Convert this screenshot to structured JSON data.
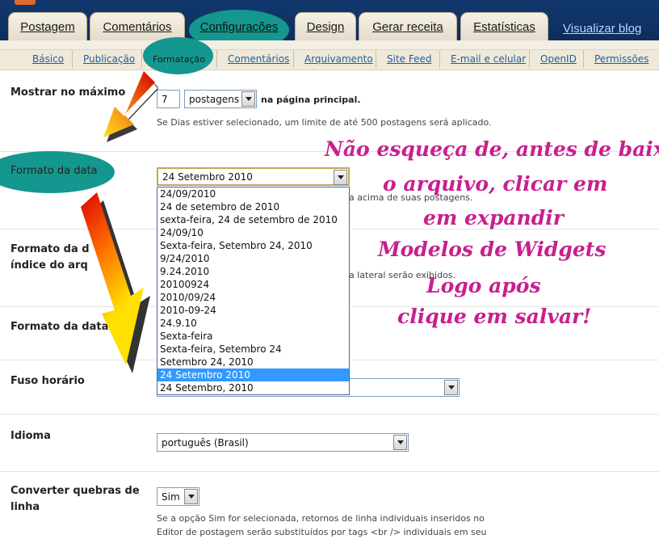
{
  "main_tabs": [
    "Postagem",
    "Comentários",
    "Configurações",
    "Design",
    "Gerar receita",
    "Estatísticas"
  ],
  "view_blog": "Visualizar blog",
  "sub_tabs": [
    "Básico",
    "Publicação",
    "Formatação",
    "Comentários",
    "Arquivamento",
    "Site Feed",
    "E-mail e celular",
    "OpenID",
    "Permissões"
  ],
  "settings": {
    "show_max": {
      "label": "Mostrar no máximo",
      "value": "7",
      "unit": "postagens",
      "suffix": "na página principal.",
      "hint": "Se Dias estiver selecionado, um limite de até 500 postagens será aplicado."
    },
    "date_format": {
      "label": "Formato da data",
      "value": "24 Setembro 2010",
      "hint_visible": "a acima de suas postagens."
    },
    "archive_format": {
      "label_line1": "Formato da d",
      "label_line2": "índice do arq",
      "hint_visible": "a lateral serão exibidos."
    },
    "comment_date": {
      "label": "Formato da data e"
    },
    "timezone": {
      "label": "Fuso horário"
    },
    "language": {
      "label": "Idioma",
      "value": "português (Brasil)"
    },
    "line_breaks": {
      "label_line1": "Converter quebras de",
      "label_line2": "linha",
      "value": "Sim",
      "hint_line1": "Se a opção Sim for selecionada, retornos de linha individuais inseridos no",
      "hint_line2": "Editor de postagem serão substituídos por tags <br /> individuais em seu"
    }
  },
  "date_options": [
    "24/09/2010",
    "24 de setembro de 2010",
    "sexta-feira, 24 de setembro de 2010",
    "24/09/10",
    "Sexta-feira, Setembro 24, 2010",
    "9/24/2010",
    "9.24.2010",
    "20100924",
    "2010/09/24",
    "2010-09-24",
    "24.9.10",
    "Sexta-feira",
    "Sexta-feira, Setembro 24",
    "Setembro 24, 2010",
    "24 Setembro 2010",
    "24 Setembro, 2010"
  ],
  "date_selected": "24 Setembro 2010",
  "note": [
    "Não esqueça de, antes de baixar",
    "o arquivo, clicar em",
    "em expandir",
    "Modelos de Widgets",
    "Logo após",
    "clique em salvar!"
  ],
  "colors": {
    "header_bg": "#12386e",
    "tab_bg": "#f6f1e5",
    "link": "#1d5f9c",
    "highlight_oval": "#14978e",
    "note_text": "#c8208f",
    "selected_option": "#3399ff"
  },
  "icons": [
    "dropdown-arrow-icon",
    "red-yellow-arrow-icon"
  ]
}
